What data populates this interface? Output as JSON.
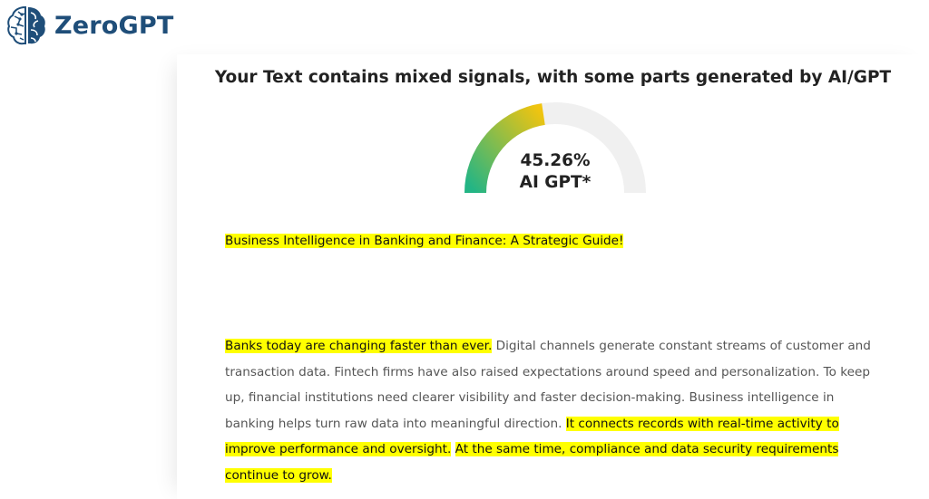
{
  "brand": {
    "name": "ZeroGPT",
    "colors": {
      "logo_text": "#1f4e79",
      "highlight": "#ffff00",
      "gauge_track": "#f0f0f0",
      "gauge_start": "#23b585",
      "gauge_end": "#f1c40f"
    }
  },
  "result": {
    "title": "Your Text contains mixed signals, with some parts generated by AI/GPT",
    "percent": 45.26,
    "percent_label": "45.26%",
    "label": "AI GPT*"
  },
  "document": {
    "heading": "Business Intelligence in Banking and Finance: A Strategic Guide!",
    "paragraph": [
      {
        "text": "Banks today are changing faster than ever.",
        "highlight": true
      },
      {
        "text": " Digital channels generate constant streams of customer and transaction data. Fintech firms have also raised expectations around speed and personalization. To keep up, financial institutions need clearer visibility and faster decision-making. Business intelligence in banking helps turn raw data into meaningful direction. ",
        "highlight": false
      },
      {
        "text": "It connects records with real-time activity to improve performance and oversight.",
        "highlight": true
      },
      {
        "text": " ",
        "highlight": false
      },
      {
        "text": "At the same time, compliance and data security requirements continue to grow.",
        "highlight": true
      }
    ]
  }
}
